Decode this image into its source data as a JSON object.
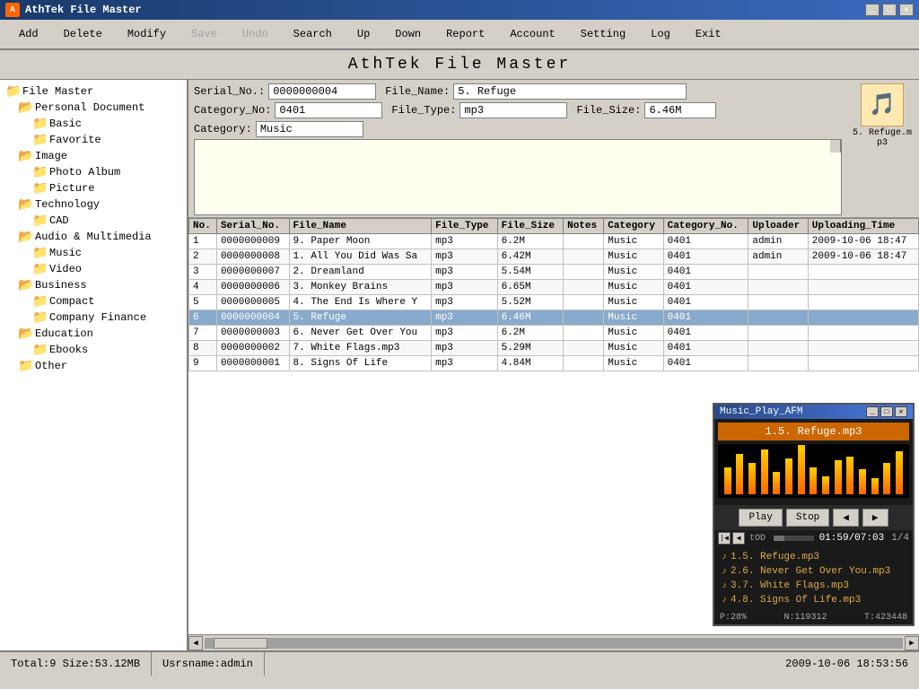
{
  "app": {
    "title": "AthTek File Master",
    "main_title": "AthTek File Master"
  },
  "toolbar": {
    "buttons": [
      "Add",
      "Delete",
      "Modify",
      "Save",
      "Undo",
      "Search",
      "Up",
      "Down",
      "Report",
      "Account",
      "Setting",
      "Log",
      "Exit"
    ],
    "disabled": [
      "Save",
      "Undo"
    ]
  },
  "detail": {
    "serial_no_label": "Serial_No.:",
    "serial_no_value": "0000000004",
    "category_no_label": "Category_No:",
    "category_no_value": "0401",
    "category_label": "Category:",
    "category_value": "Music",
    "file_name_label": "File_Name:",
    "file_name_value": "5. Refuge",
    "file_type_label": "File_Type:",
    "file_type_value": "mp3",
    "file_size_label": "File_Size:",
    "file_size_value": "6.46M"
  },
  "preview": {
    "icon": "🎵",
    "label": "5. Refuge.mp3"
  },
  "sidebar": {
    "items": [
      {
        "level": 0,
        "label": "File Master",
        "icon": "folder",
        "expanded": true
      },
      {
        "level": 1,
        "label": "Personal Document",
        "icon": "folder",
        "expanded": true
      },
      {
        "level": 2,
        "label": "Basic",
        "icon": "folder"
      },
      {
        "level": 2,
        "label": "Favorite",
        "icon": "folder"
      },
      {
        "level": 1,
        "label": "Image",
        "icon": "folder",
        "expanded": true
      },
      {
        "level": 2,
        "label": "Photo Album",
        "icon": "folder"
      },
      {
        "level": 2,
        "label": "Picture",
        "icon": "folder"
      },
      {
        "level": 1,
        "label": "Technology",
        "icon": "folder",
        "expanded": true
      },
      {
        "level": 2,
        "label": "CAD",
        "icon": "folder"
      },
      {
        "level": 1,
        "label": "Audio & Multimedia",
        "icon": "folder",
        "expanded": true
      },
      {
        "level": 2,
        "label": "Music",
        "icon": "folder"
      },
      {
        "level": 2,
        "label": "Video",
        "icon": "folder"
      },
      {
        "level": 1,
        "label": "Business",
        "icon": "folder",
        "expanded": true
      },
      {
        "level": 2,
        "label": "Compact",
        "icon": "folder"
      },
      {
        "level": 2,
        "label": "Company Finance",
        "icon": "folder"
      },
      {
        "level": 1,
        "label": "Education",
        "icon": "folder",
        "expanded": true
      },
      {
        "level": 2,
        "label": "Ebooks",
        "icon": "folder"
      },
      {
        "level": 1,
        "label": "Other",
        "icon": "folder"
      }
    ]
  },
  "table": {
    "columns": [
      "No.",
      "Serial_No.",
      "File_Name",
      "File_Type",
      "File_Size",
      "Notes",
      "Category",
      "Category_No.",
      "Uploader",
      "Uploading_Time"
    ],
    "rows": [
      {
        "no": "1",
        "serial": "0000000009",
        "name": "9. Paper Moon",
        "type": "mp3",
        "size": "6.2M",
        "notes": "",
        "category": "Music",
        "cat_no": "0401",
        "uploader": "admin",
        "time": "2009-10-06 18:47",
        "selected": false
      },
      {
        "no": "2",
        "serial": "0000000008",
        "name": "1. All You Did Was Sa",
        "type": "mp3",
        "size": "6.42M",
        "notes": "",
        "category": "Music",
        "cat_no": "0401",
        "uploader": "admin",
        "time": "2009-10-06 18:47",
        "selected": false
      },
      {
        "no": "3",
        "serial": "0000000007",
        "name": "2. Dreamland",
        "type": "mp3",
        "size": "5.54M",
        "notes": "",
        "category": "Music",
        "cat_no": "0401",
        "uploader": "",
        "time": "",
        "selected": false
      },
      {
        "no": "4",
        "serial": "0000000006",
        "name": "3. Monkey Brains",
        "type": "mp3",
        "size": "6.65M",
        "notes": "",
        "category": "Music",
        "cat_no": "0401",
        "uploader": "",
        "time": "",
        "selected": false
      },
      {
        "no": "5",
        "serial": "0000000005",
        "name": "4. The End Is Where Y",
        "type": "mp3",
        "size": "5.52M",
        "notes": "",
        "category": "Music",
        "cat_no": "0401",
        "uploader": "",
        "time": "",
        "selected": false
      },
      {
        "no": "6",
        "serial": "0000000004",
        "name": "5. Refuge",
        "type": "mp3",
        "size": "6.46M",
        "notes": "",
        "category": "Music",
        "cat_no": "0401",
        "uploader": "",
        "time": "",
        "selected": true
      },
      {
        "no": "7",
        "serial": "0000000003",
        "name": "6. Never Get Over You",
        "type": "mp3",
        "size": "6.2M",
        "notes": "",
        "category": "Music",
        "cat_no": "0401",
        "uploader": "",
        "time": "",
        "selected": false
      },
      {
        "no": "8",
        "serial": "0000000002",
        "name": "7. White Flags.mp3",
        "type": "mp3",
        "size": "5.29M",
        "notes": "",
        "category": "Music",
        "cat_no": "0401",
        "uploader": "",
        "time": "",
        "selected": false
      },
      {
        "no": "9",
        "serial": "0000000001",
        "name": "8. Signs Of Life",
        "type": "mp3",
        "size": "4.84M",
        "notes": "",
        "category": "Music",
        "cat_no": "0401",
        "uploader": "",
        "time": "",
        "selected": false
      }
    ]
  },
  "status": {
    "total": "Total:9 Size:53.12MB",
    "username": "Usrsname:admin",
    "datetime": "2009-10-06 18:53:56"
  },
  "player": {
    "title": "Music_Play_AFM",
    "track": "1.5. Refuge.mp3",
    "time": "01:59/07:03",
    "track_count": "1/4",
    "playlist": [
      "1.5. Refuge.mp3",
      "2.6. Never Get Over You.mp3",
      "3.7. White Flags.mp3",
      "4.8. Signs Of Life.mp3"
    ],
    "footer_p": "P:28%",
    "footer_n": "N:119312",
    "footer_t": "T:423448",
    "tod_label": "tOD",
    "play_btn": "Play",
    "stop_btn": "Stop"
  }
}
